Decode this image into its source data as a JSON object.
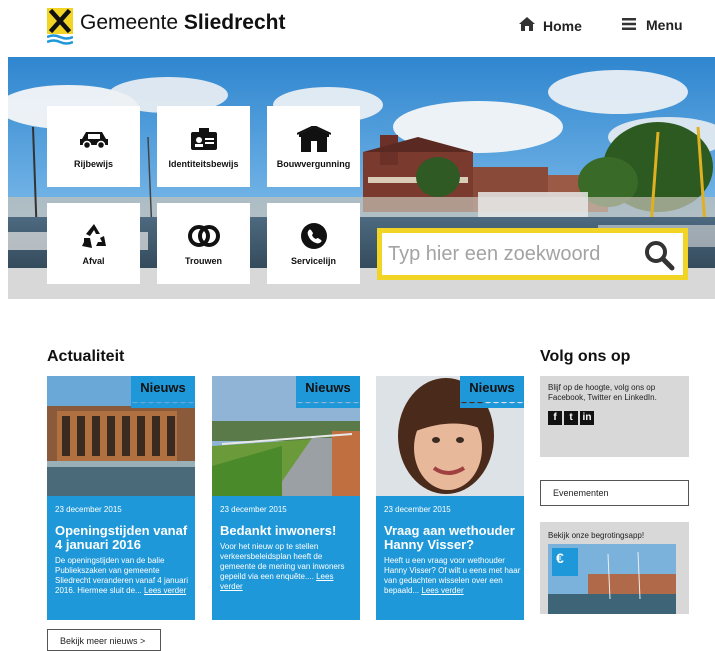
{
  "header": {
    "logo_text_regular": "Gemeente",
    "logo_text_bold": "Sliedrecht",
    "nav_home": "Home",
    "nav_menu": "Menu"
  },
  "tiles": [
    {
      "label": "Rijbewijs",
      "icon": "car-icon"
    },
    {
      "label": "Identiteitsbewijs",
      "icon": "id-card-icon"
    },
    {
      "label": "Bouwvergunning",
      "icon": "house-box-icon"
    },
    {
      "label": "Afval",
      "icon": "recycle-icon"
    },
    {
      "label": "Trouwen",
      "icon": "rings-icon"
    },
    {
      "label": "Servicelijn",
      "icon": "phone-icon"
    }
  ],
  "search": {
    "placeholder": "Typ hier een zoekwoord"
  },
  "news": {
    "section_title": "Actualiteit",
    "badge": "Nieuws",
    "cards": [
      {
        "date": "23 december 2015",
        "title": "Openingstijden vanaf 4 januari 2016",
        "text": "De openingstijden van de balie Publiekszaken van gemeente Sliedrecht veranderen vanaf 4 januari 2016. Hiermee sluit de...",
        "link": "Lees verder"
      },
      {
        "date": "23 december 2015",
        "title": "Bedankt inwoners!",
        "text": "Voor het nieuw op te stellen verkeersbeleidsplan heeft de gemeente de mening van inwoners gepeild via een enquête....",
        "link": "Lees verder"
      },
      {
        "date": "23 december 2015",
        "title": "Vraag aan wethouder Hanny Visser?",
        "text": "Heeft u een vraag voor wethouder Hanny Visser? Of wilt u eens met haar van gedachten wisselen over een bepaald...",
        "link": "Lees verder"
      }
    ],
    "more_button": "Bekijk meer nieuws >"
  },
  "sidebar": {
    "title": "Volg ons op",
    "social_text": "Blijf op de hoogte, volg ons op Facebook, Twitter en LinkedIn.",
    "social_icons": [
      {
        "name": "facebook-icon",
        "glyph": "f"
      },
      {
        "name": "twitter-icon",
        "glyph": "t"
      },
      {
        "name": "linkedin-icon",
        "glyph": "in"
      }
    ],
    "events_button": "Evenementen",
    "app_text": "Bekijk onze begrotingsapp!",
    "app_badge": "€"
  },
  "colors": {
    "accent_blue": "#1f98d9",
    "search_yellow": "#f2d524",
    "panel_gray": "#d8d8d8"
  }
}
